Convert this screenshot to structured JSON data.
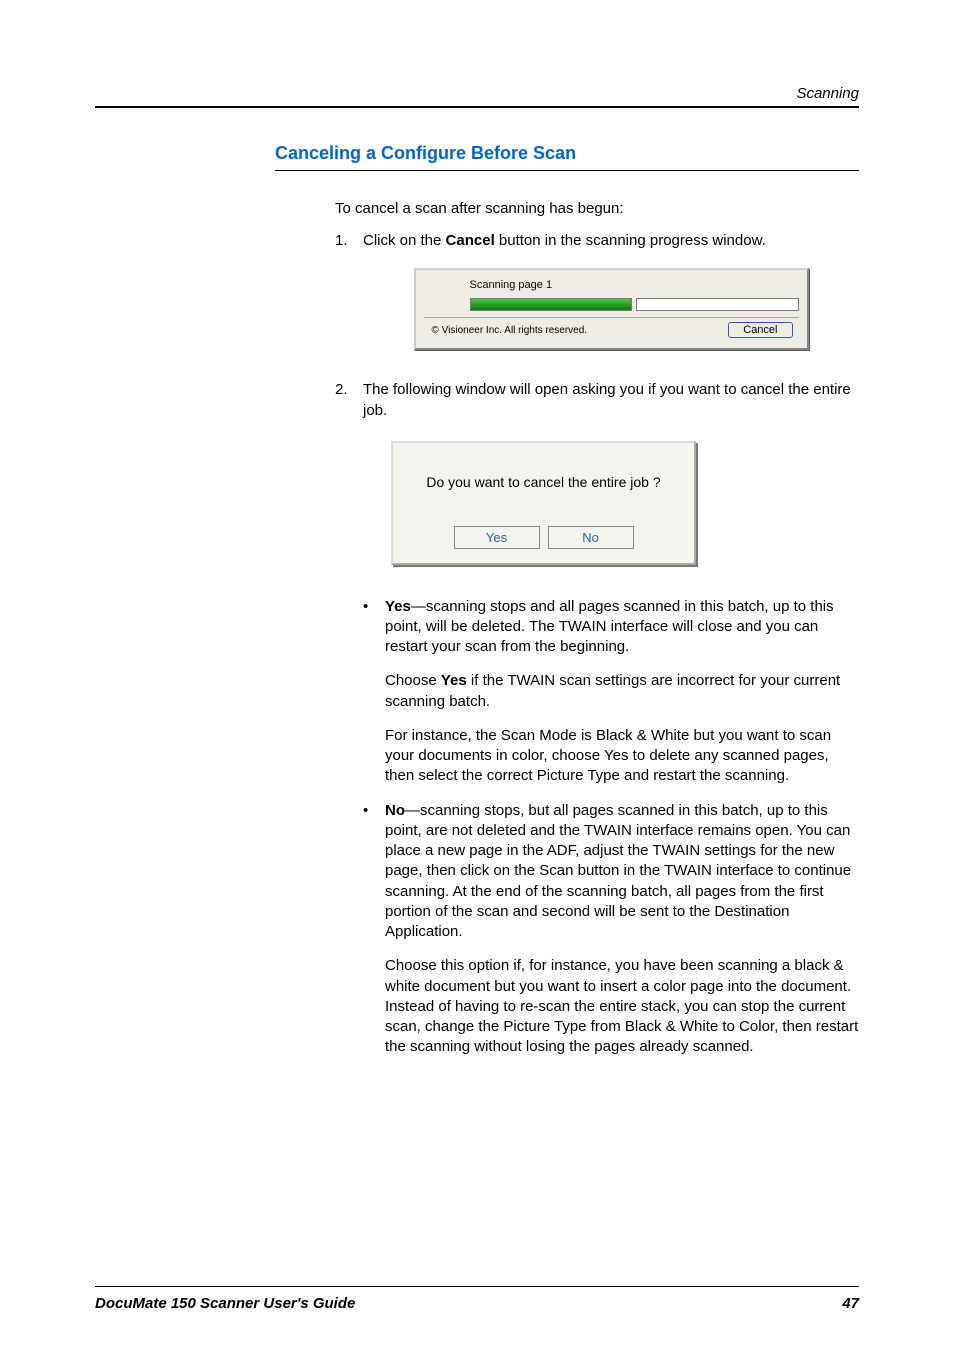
{
  "header": {
    "section": "Scanning"
  },
  "title": "Canceling a Configure Before Scan",
  "intro": "To cancel a scan after scanning has begun:",
  "steps": {
    "s1": {
      "num": "1.",
      "pre": "Click on the ",
      "bold": "Cancel",
      "post": " button in the scanning progress window."
    },
    "s2": {
      "num": "2.",
      "text": "The following window will open asking you if you want to cancel the entire job."
    }
  },
  "progress": {
    "label": "Scanning page 1",
    "copyright": "© Visioneer Inc. All rights reserved.",
    "cancel": "Cancel"
  },
  "confirm": {
    "msg": "Do you want to cancel the entire job ?",
    "yes": "Yes",
    "no": "No"
  },
  "bullets": {
    "yes": {
      "bold": "Yes",
      "rest": "—scanning stops and all pages scanned in this batch, up to this point, will be deleted. The TWAIN interface will close and you can restart your scan from the beginning.",
      "p2a": "Choose ",
      "p2bold": "Yes",
      "p2b": " if the TWAIN scan settings are incorrect for your current scanning batch.",
      "p3": "For instance, the Scan Mode is Black & White but you want to scan your documents in color, choose Yes to delete any scanned pages, then select the correct Picture Type and restart the scanning."
    },
    "no": {
      "bold": "No",
      "rest": "—scanning stops, but all pages scanned in this batch, up to this point, are not deleted and the TWAIN interface remains open. You can place a new page in the ADF, adjust the TWAIN settings for the new page, then click on the Scan button in the TWAIN interface to continue scanning. At the end of the scanning batch, all pages from the first portion of the scan and second will be sent to the Destination Application.",
      "p2": "Choose this option if, for instance, you have been scanning a black & white document but you want to insert a color page into the document. Instead of having to re-scan the entire stack, you can stop the current scan, change the Picture Type from Black & White to Color, then restart the scanning without losing the pages already scanned."
    }
  },
  "footer": {
    "title": "DocuMate 150 Scanner User's Guide",
    "page": "47"
  }
}
